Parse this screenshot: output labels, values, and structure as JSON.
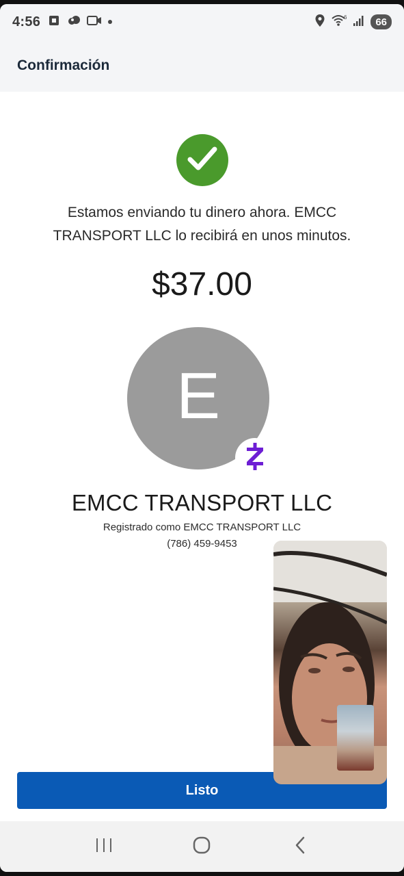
{
  "status_bar": {
    "time": "4:56",
    "battery": "66",
    "network_badge": "6"
  },
  "header": {
    "title": "Confirmación"
  },
  "confirmation": {
    "message": "Estamos enviando tu dinero ahora. EMCC TRANSPORT LLC lo recibirá en unos minutos.",
    "amount": "$37.00"
  },
  "recipient": {
    "avatar_letter": "E",
    "name": "EMCC TRANSPORT LLC",
    "registered_as": "Registrado como EMCC TRANSPORT LLC",
    "phone": "(786) 459-9453"
  },
  "actions": {
    "done_label": "Listo"
  },
  "colors": {
    "success": "#4a9a2c",
    "primary_button": "#0a5ab5",
    "zelle_purple": "#6d1ed4",
    "avatar_gray": "#9b9b9b"
  },
  "icons": [
    "chase-icon",
    "cloud-icon",
    "video-icon",
    "location-icon",
    "wifi-icon",
    "signal-icon",
    "check-icon",
    "zelle-icon",
    "recents-icon",
    "home-icon",
    "back-icon"
  ]
}
